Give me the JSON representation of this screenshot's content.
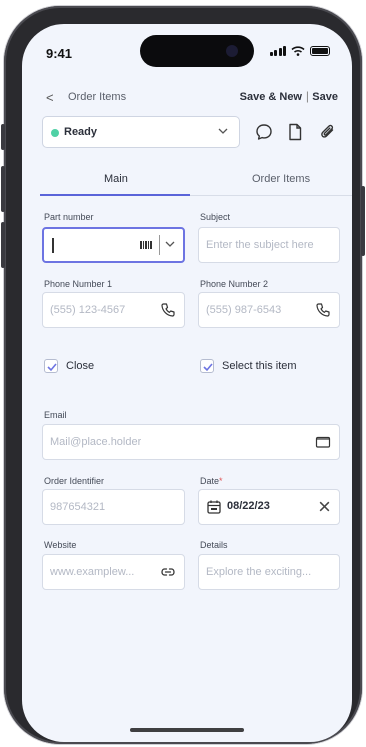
{
  "status_bar": {
    "time": "9:41"
  },
  "header": {
    "back_symbol": "<",
    "title": "Order Items",
    "save_new_label": "Save & New",
    "separator": "|",
    "save_label": "Save"
  },
  "status_select": {
    "value": "Ready",
    "dot_color": "#4fd1a5"
  },
  "toolbar": {
    "icons": [
      "chat-icon",
      "document-icon",
      "attachment-icon"
    ]
  },
  "tabs": [
    {
      "label": "Main",
      "active": true
    },
    {
      "label": "Order Items",
      "active": false
    }
  ],
  "form": {
    "part_number": {
      "label": "Part number",
      "value": ""
    },
    "subject": {
      "label": "Subject",
      "placeholder": "Enter the subject here"
    },
    "phone1": {
      "label": "Phone Number 1",
      "placeholder": "(555) 123-4567"
    },
    "phone2": {
      "label": "Phone Number 2",
      "placeholder": "(555) 987-6543"
    },
    "close": {
      "label": "Close",
      "checked": true
    },
    "select_item": {
      "label": "Select this item",
      "checked": true
    },
    "email": {
      "label": "Email",
      "placeholder": "Mail@place.holder"
    },
    "order_identifier": {
      "label": "Order Identifier",
      "placeholder": "987654321"
    },
    "date": {
      "label": "Date",
      "required_mark": "*",
      "value": "08/22/23"
    },
    "website": {
      "label": "Website",
      "placeholder": "www.examplew..."
    },
    "details": {
      "label": "Details",
      "placeholder": "Explore the exciting..."
    }
  },
  "colors": {
    "accent": "#5a64d9",
    "background": "#f2f5fc",
    "status_dot": "#4fd1a5"
  }
}
